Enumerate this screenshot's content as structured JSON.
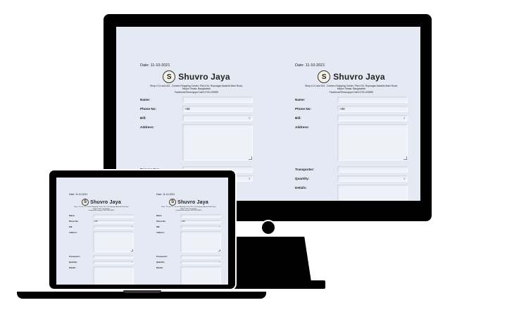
{
  "receipt": {
    "date_label": "Date:",
    "date_value": "11-10-2021",
    "logo_letter": "S",
    "shop_name": "Shuvro Jaya",
    "address_line1": "Shop # 11 and #21 , Doreen Shopping Center, Plot # 04, Rupnagar Abashik Main Road,",
    "address_line2": "Mirpur Dhaka, Bangladesh",
    "address_line3": "Facebook/Shuvrojaya Call:01700-203990",
    "fields": {
      "name": "Name:",
      "phone": "Phone No:",
      "phone_prefix": "+88",
      "bill": "Bill:",
      "address": "Address:",
      "transporter": "Transporter:",
      "quantity": "Quantity:",
      "details": "Details:"
    }
  },
  "colors": {
    "screen_bg": "#e4e9f3",
    "device": "#000000"
  }
}
